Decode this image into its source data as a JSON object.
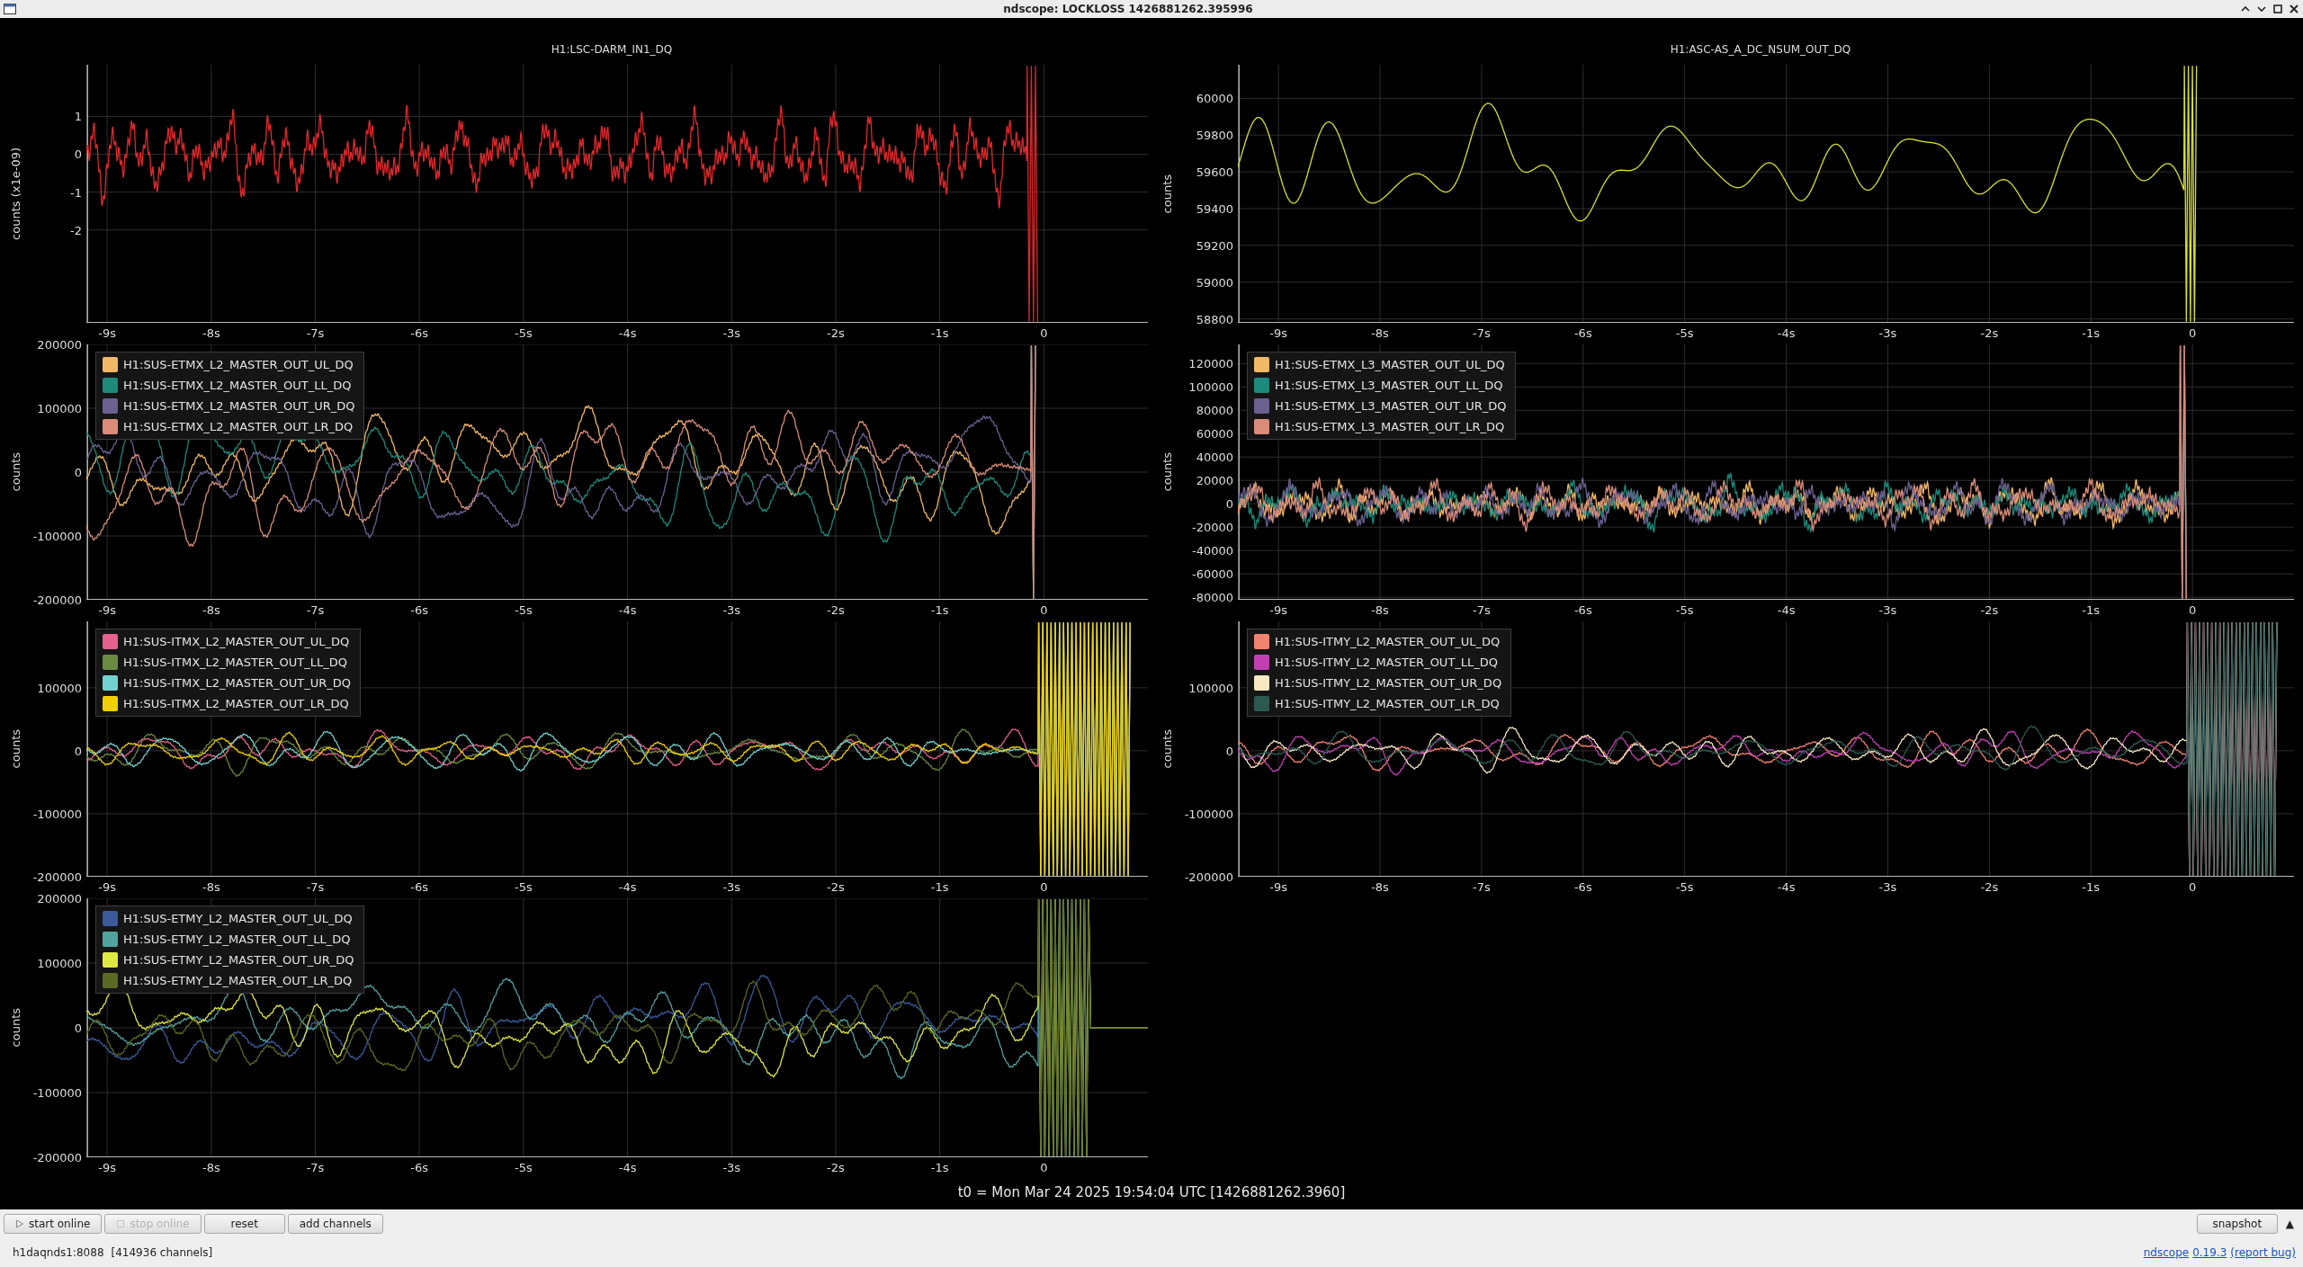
{
  "window": {
    "title": "ndscope: LOCKLOSS 1426881262.395996"
  },
  "plots": [
    {
      "title": "H1:LSC-DARM_IN1_DQ",
      "ylabel": "counts (x1e-09)",
      "color": "#e0282c",
      "yticks": [
        "1",
        "0",
        "-1",
        "-2"
      ],
      "xticks": [
        "-9s",
        "-8s",
        "-7s",
        "-6s",
        "-5s",
        "-4s",
        "-3s",
        "-2s",
        "-1s",
        "0"
      ]
    },
    {
      "title": "H1:ASC-AS_A_DC_NSUM_OUT_DQ",
      "ylabel": "counts",
      "color": "#d8e234",
      "yticks": [
        "60000",
        "59800",
        "59600",
        "59400",
        "59200",
        "59000",
        "58800"
      ],
      "xticks": [
        "-9s",
        "-8s",
        "-7s",
        "-6s",
        "-5s",
        "-4s",
        "-3s",
        "-2s",
        "-1s",
        "0"
      ]
    },
    {
      "ylabel": "counts",
      "yticks": [
        "200000",
        "100000",
        "0",
        "-100000",
        "-200000"
      ],
      "xticks": [
        "-9s",
        "-8s",
        "-7s",
        "-6s",
        "-5s",
        "-4s",
        "-3s",
        "-2s",
        "-1s",
        "0"
      ],
      "legend": [
        {
          "label": "H1:SUS-ETMX_L2_MASTER_OUT_UL_DQ",
          "color": "#f2b866"
        },
        {
          "label": "H1:SUS-ETMX_L2_MASTER_OUT_LL_DQ",
          "color": "#1b8a7a"
        },
        {
          "label": "H1:SUS-ETMX_L2_MASTER_OUT_UR_DQ",
          "color": "#6c6090"
        },
        {
          "label": "H1:SUS-ETMX_L2_MASTER_OUT_LR_DQ",
          "color": "#d98c78"
        }
      ]
    },
    {
      "ylabel": "counts",
      "yticks": [
        "120000",
        "100000",
        "80000",
        "60000",
        "40000",
        "20000",
        "0",
        "-20000",
        "-40000",
        "-60000",
        "-80000"
      ],
      "xticks": [
        "-9s",
        "-8s",
        "-7s",
        "-6s",
        "-5s",
        "-4s",
        "-3s",
        "-2s",
        "-1s",
        "0"
      ],
      "legend": [
        {
          "label": "H1:SUS-ETMX_L3_MASTER_OUT_UL_DQ",
          "color": "#f2b866"
        },
        {
          "label": "H1:SUS-ETMX_L3_MASTER_OUT_LL_DQ",
          "color": "#1b8a7a"
        },
        {
          "label": "H1:SUS-ETMX_L3_MASTER_OUT_UR_DQ",
          "color": "#6c6090"
        },
        {
          "label": "H1:SUS-ETMX_L3_MASTER_OUT_LR_DQ",
          "color": "#d98c78"
        }
      ]
    },
    {
      "ylabel": "counts",
      "yticks": [
        "100000",
        "0",
        "-100000",
        "-200000"
      ],
      "xticks": [
        "-9s",
        "-8s",
        "-7s",
        "-6s",
        "-5s",
        "-4s",
        "-3s",
        "-2s",
        "-1s",
        "0"
      ],
      "legend": [
        {
          "label": "H1:SUS-ITMX_L2_MASTER_OUT_UL_DQ",
          "color": "#e8608c"
        },
        {
          "label": "H1:SUS-ITMX_L2_MASTER_OUT_LL_DQ",
          "color": "#6a8a42"
        },
        {
          "label": "H1:SUS-ITMX_L2_MASTER_OUT_UR_DQ",
          "color": "#72d2d0"
        },
        {
          "label": "H1:SUS-ITMX_L2_MASTER_OUT_LR_DQ",
          "color": "#f2d000"
        }
      ]
    },
    {
      "ylabel": "counts",
      "yticks": [
        "100000",
        "0",
        "-100000",
        "-200000"
      ],
      "xticks": [
        "-9s",
        "-8s",
        "-7s",
        "-6s",
        "-5s",
        "-4s",
        "-3s",
        "-2s",
        "-1s",
        "0"
      ],
      "legend": [
        {
          "label": "H1:SUS-ITMY_L2_MASTER_OUT_UL_DQ",
          "color": "#f08270"
        },
        {
          "label": "H1:SUS-ITMY_L2_MASTER_OUT_LL_DQ",
          "color": "#c040b4"
        },
        {
          "label": "H1:SUS-ITMY_L2_MASTER_OUT_UR_DQ",
          "color": "#f8e8c4"
        },
        {
          "label": "H1:SUS-ITMY_L2_MASTER_OUT_LR_DQ",
          "color": "#2c5a52"
        }
      ]
    },
    {
      "ylabel": "counts",
      "yticks": [
        "200000",
        "100000",
        "0",
        "-100000",
        "-200000"
      ],
      "xticks": [
        "-9s",
        "-8s",
        "-7s",
        "-6s",
        "-5s",
        "-4s",
        "-3s",
        "-2s",
        "-1s",
        "0"
      ],
      "legend": [
        {
          "label": "H1:SUS-ETMY_L2_MASTER_OUT_UL_DQ",
          "color": "#3a5a9a"
        },
        {
          "label": "H1:SUS-ETMY_L2_MASTER_OUT_LL_DQ",
          "color": "#52a2a0"
        },
        {
          "label": "H1:SUS-ETMY_L2_MASTER_OUT_UR_DQ",
          "color": "#e0e842"
        },
        {
          "label": "H1:SUS-ETMY_L2_MASTER_OUT_LR_DQ",
          "color": "#5a6a22"
        }
      ]
    }
  ],
  "t0": "t0 = Mon Mar 24 2025 19:54:04 UTC [1426881262.3960]",
  "toolbar": {
    "buttons": [
      {
        "label": "start online",
        "kind": "start",
        "disabled": false
      },
      {
        "label": "stop online",
        "kind": "stop",
        "disabled": true
      },
      {
        "label": "reset",
        "kind": "plain",
        "disabled": false
      },
      {
        "label": "add channels",
        "kind": "plain",
        "disabled": false
      }
    ],
    "snapshot": "snapshot",
    "expand": "▲"
  },
  "status_bar": {
    "server": "h1daqnds1:8088",
    "channels": "[414936 channels]",
    "links": [
      "ndscope",
      "0.19.3",
      "(report bug)"
    ]
  }
}
